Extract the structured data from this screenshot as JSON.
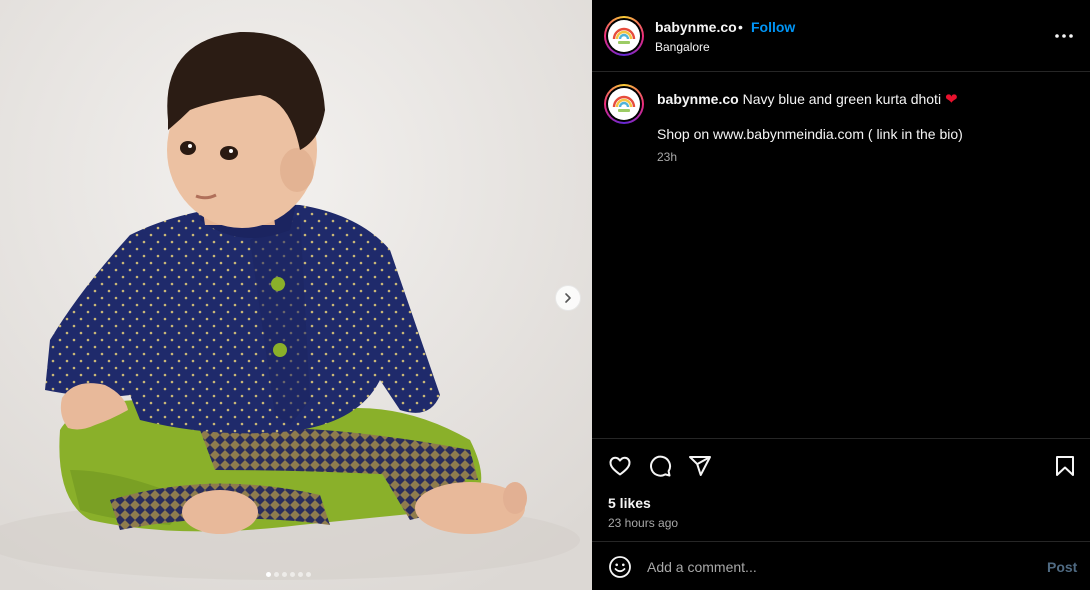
{
  "post": {
    "username": "babynme.co",
    "separator": "•",
    "follow_label": "Follow",
    "location": "Bangalore",
    "more_icon": "more-horizontal-icon"
  },
  "caption": {
    "username": "babynme.co",
    "text": "Navy blue and green kurta dhoti",
    "emoji": "❤",
    "line2": "Shop on www.babynmeindia.com ( link in the bio)",
    "time": "23h"
  },
  "actions": {
    "icons": [
      "heart-icon",
      "comment-icon",
      "share-icon",
      "bookmark-icon"
    ],
    "likes": "5 likes",
    "posted": "23 hours ago"
  },
  "comment": {
    "placeholder": "Add a comment...",
    "post_label": "Post"
  },
  "media": {
    "slide_count": 6,
    "active_slide": 1,
    "next_icon": "chevron-right-icon"
  },
  "colors": {
    "accent": "#0095f6",
    "background": "#000000",
    "post_disabled": "#4f6a82",
    "kurta_navy": "#1f2a6b",
    "dhoti_green": "#8ab02a"
  }
}
